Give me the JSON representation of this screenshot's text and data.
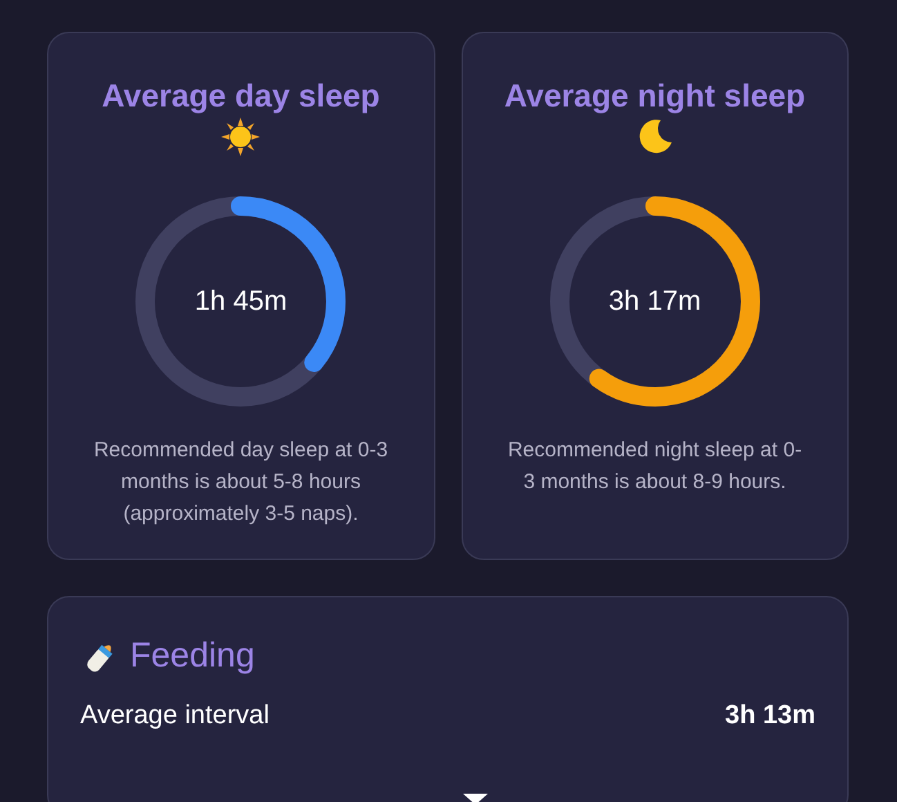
{
  "sleep_cards": [
    {
      "kind": "day",
      "title": "Average day sleep",
      "color": "#3b89f6",
      "value": "1h 45m",
      "note": "Recommended day sleep at 0-3 months is about 5-8 hours (approximately 3-5 naps)."
    },
    {
      "kind": "night",
      "title": "Average night sleep",
      "color": "#f59e0b",
      "value": "3h 17m",
      "note": "Recommended night sleep at 0-3 months is about 8-9 hours."
    }
  ],
  "feeding": {
    "title": "Feeding",
    "rows": [
      {
        "label": "Average interval",
        "value": "3h 13m"
      }
    ]
  }
}
